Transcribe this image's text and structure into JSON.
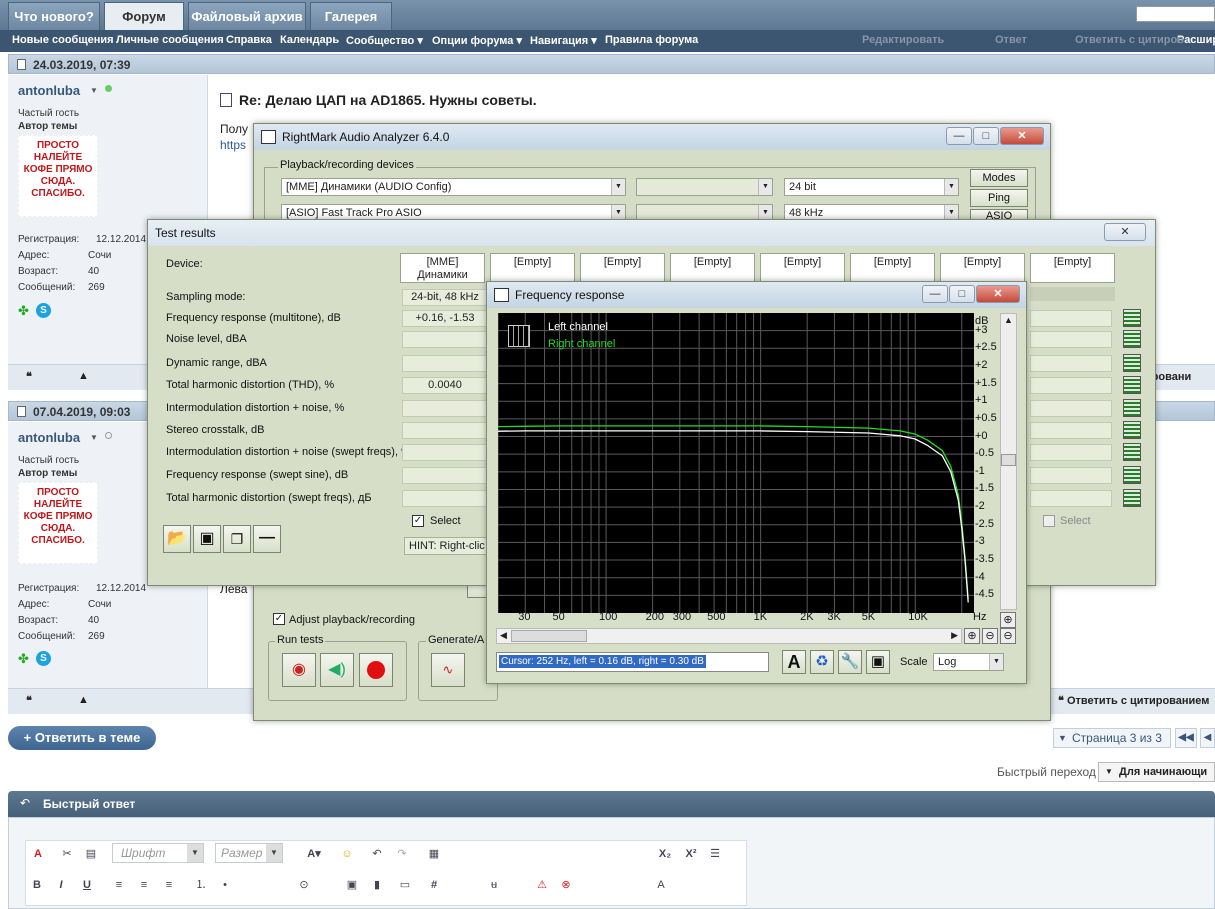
{
  "forum": {
    "tabs": [
      "Что нового?",
      "Форум",
      "Файловый архив",
      "Галерея"
    ],
    "nav": [
      "Новые сообщения",
      "Личные сообщения",
      "Справка",
      "Календарь",
      "Сообщество ▾",
      "Опции форума ▾",
      "Навигация ▾",
      "Правила форума"
    ],
    "nav_right": "Расшир",
    "faded_actions": [
      "Редактировать",
      "Ответ",
      "Ответить с цитиров"
    ],
    "posts": [
      {
        "date": "24.03.2019, 07:39",
        "user": "antonluba",
        "rank": "Частый гость",
        "role": "Автор темы",
        "reg_label": "Регистрация:",
        "reg": "12.12.2014",
        "addr_label": "Адрес:",
        "addr": "Сочи",
        "age_label": "Возраст:",
        "age": "40",
        "msgs_label": "Сообщений:",
        "msgs": "269",
        "title": "Re: Делаю ЦАП на AD1865. Нужны советы.",
        "body_partial": "Полу",
        "body_link_partial": "https"
      },
      {
        "date": "07.04.2019, 09:03",
        "user": "antonluba",
        "rank": "Частый гость",
        "role": "Автор темы",
        "reg_label": "Регистрация:",
        "reg": "12.12.2014",
        "addr_label": "Адрес:",
        "addr": "Сочи",
        "age_label": "Возраст:",
        "age": "40",
        "msgs_label": "Сообщений:",
        "msgs": "269",
        "body_partial": "Лева"
      }
    ],
    "avatar_text": "ПРОСТО НАЛЕЙТЕ КОФЕ ПРЯМО СЮДА. СПАСИБО.",
    "quote_reply": "Ответить с цитированием",
    "quote_reply_partial": "цитировани",
    "reply_button": "+ Ответить в теме",
    "pagination": "Страница 3 из 3",
    "quick_nav_label": "Быстрый переход",
    "quick_nav_select": "Для начинающи",
    "quick_reply": "Быстрый ответ",
    "editor": {
      "font": "Шрифт",
      "size": "Размер"
    }
  },
  "rmaa": {
    "title": "RightMark Audio Analyzer 6.4.0",
    "group_devices": "Playback/recording devices",
    "playback_device": "[MME] Динамики (AUDIO Config)",
    "recording_device": "[ASIO] Fast Track Pro ASIO",
    "bits": "24 bit",
    "rate": "48 kHz",
    "btn_modes": "Modes",
    "btn_ping": "Ping",
    "btn_asio": "ASIO",
    "adjust_label": "Adjust playback/recording",
    "run_tests": "Run tests",
    "generate": "Generate/A"
  },
  "test_results": {
    "title": "Test results",
    "device_label": "Device:",
    "columns": [
      "[MME] Динамики",
      "[Empty]",
      "[Empty]",
      "[Empty]",
      "[Empty]",
      "[Empty]",
      "[Empty]",
      "[Empty]"
    ],
    "rows": [
      {
        "label": "Sampling mode:",
        "value": "24-bit, 48 kHz"
      },
      {
        "label": "Frequency response (multitone), dB",
        "value": "+0.16, -1.53"
      },
      {
        "label": "Noise level, dBA",
        "value": ""
      },
      {
        "label": "Dynamic range, dBA",
        "value": ""
      },
      {
        "label": "Total harmonic distortion (THD), %",
        "value": "0.0040"
      },
      {
        "label": "Intermodulation distortion + noise, %",
        "value": ""
      },
      {
        "label": "Stereo crosstalk, dB",
        "value": ""
      },
      {
        "label": "Intermodulation distortion + noise (swept freqs), %",
        "value": ""
      },
      {
        "label": "Frequency response (swept sine), dB",
        "value": ""
      },
      {
        "label": "Total harmonic distortion (swept freqs), дБ",
        "value": ""
      }
    ],
    "select_label": "Select",
    "select_label_right": "Select",
    "hint": "HINT: Right-clic"
  },
  "freq_response": {
    "title": "Frequency response",
    "legend_left": "Left channel",
    "legend_right": "Right channel",
    "y_unit": "dB",
    "y_labels": [
      "+3",
      "+2.5",
      "+2",
      "+1.5",
      "+1",
      "+0.5",
      "+0",
      "-0.5",
      "-1",
      "-1.5",
      "-2",
      "-2.5",
      "-3",
      "-3.5",
      "-4",
      "-4.5"
    ],
    "x_unit": "Hz",
    "x_labels": [
      "30",
      "50",
      "100",
      "200",
      "300",
      "500",
      "1K",
      "2K",
      "3K",
      "5K",
      "10K"
    ],
    "cursor": "Cursor:  252 Hz,  left = 0.16 dB,  right = 0.30 dB",
    "scale_label": "Scale",
    "scale_value": "Log",
    "colors": {
      "left": "#ffffff",
      "right": "#22dd22",
      "grid": "#5a5a5a"
    }
  },
  "chart_data": {
    "type": "line",
    "title": "Frequency response",
    "xlabel": "Hz",
    "ylabel": "dB",
    "xscale": "log",
    "xlim": [
      20,
      24000
    ],
    "ylim": [
      -5,
      3.5
    ],
    "grid": true,
    "legend": "top-left",
    "series": [
      {
        "name": "Left channel",
        "color": "#ffffff",
        "x": [
          20,
          30,
          50,
          100,
          252,
          500,
          1000,
          2000,
          5000,
          8000,
          10000,
          12000,
          15000,
          17000,
          19000,
          20000,
          21000,
          22000
        ],
        "y": [
          0.15,
          0.16,
          0.16,
          0.16,
          0.16,
          0.16,
          0.16,
          0.14,
          0.1,
          0.02,
          -0.07,
          -0.25,
          -0.55,
          -1.0,
          -1.8,
          -2.6,
          -3.5,
          -4.7
        ]
      },
      {
        "name": "Right channel",
        "color": "#22dd22",
        "x": [
          20,
          30,
          50,
          100,
          252,
          500,
          1000,
          2000,
          5000,
          8000,
          10000,
          12000,
          15000,
          17000,
          19000,
          20000,
          21000,
          22000
        ],
        "y": [
          0.28,
          0.29,
          0.3,
          0.3,
          0.3,
          0.3,
          0.3,
          0.28,
          0.24,
          0.16,
          0.07,
          -0.1,
          -0.4,
          -0.85,
          -1.65,
          -2.45,
          -3.4,
          -4.6
        ]
      }
    ]
  }
}
